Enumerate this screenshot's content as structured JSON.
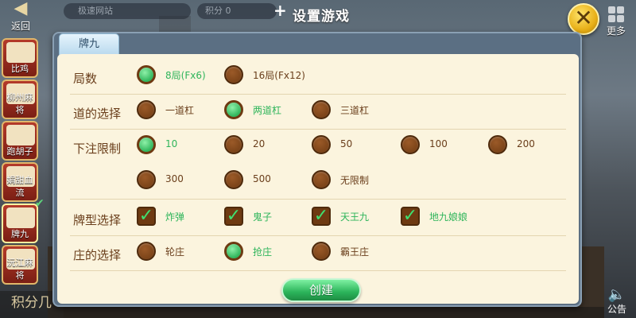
{
  "topbar": {
    "back_label": "返回",
    "search_placeholder": "极速网站",
    "score_text": "积分 0",
    "title": "设置游戏",
    "more_label": "更多"
  },
  "sidebar": {
    "items": [
      {
        "label": "比鸡",
        "active": false
      },
      {
        "label": "柳州麻将",
        "active": false
      },
      {
        "label": "跑胡子",
        "active": false
      },
      {
        "label": "娟甜血流",
        "active": false
      },
      {
        "label": "牌九",
        "active": true
      },
      {
        "label": "沅江麻将",
        "active": false
      }
    ],
    "bottom_label": "积分几"
  },
  "notice_label": "公告",
  "dialog": {
    "tab_label": "牌九",
    "rows": [
      {
        "label": "局数",
        "options": [
          {
            "label": "8局(Fx6)",
            "selected": true
          },
          {
            "label": "16局(Fx12)",
            "selected": false
          }
        ]
      },
      {
        "label": "道的选择",
        "options": [
          {
            "label": "一道杠",
            "selected": false
          },
          {
            "label": "两道杠",
            "selected": true
          },
          {
            "label": "三道杠",
            "selected": false
          }
        ]
      },
      {
        "label": "下注限制",
        "options": [
          {
            "label": "10",
            "selected": true
          },
          {
            "label": "20",
            "selected": false
          },
          {
            "label": "50",
            "selected": false
          },
          {
            "label": "100",
            "selected": false
          },
          {
            "label": "200",
            "selected": false
          },
          {
            "label": "300",
            "selected": false
          },
          {
            "label": "500",
            "selected": false
          },
          {
            "label": "无限制",
            "selected": false
          }
        ]
      },
      {
        "label": "牌型选择",
        "options": [
          {
            "label": "炸弹",
            "checked": true
          },
          {
            "label": "鬼子",
            "checked": true
          },
          {
            "label": "天王九",
            "checked": true
          },
          {
            "label": "地九娘娘",
            "checked": true
          }
        ]
      },
      {
        "label": "庄的选择",
        "options": [
          {
            "label": "轮庄",
            "selected": false
          },
          {
            "label": "抢庄",
            "selected": true
          },
          {
            "label": "霸王庄",
            "selected": false
          }
        ]
      }
    ],
    "create_label": "创建"
  }
}
